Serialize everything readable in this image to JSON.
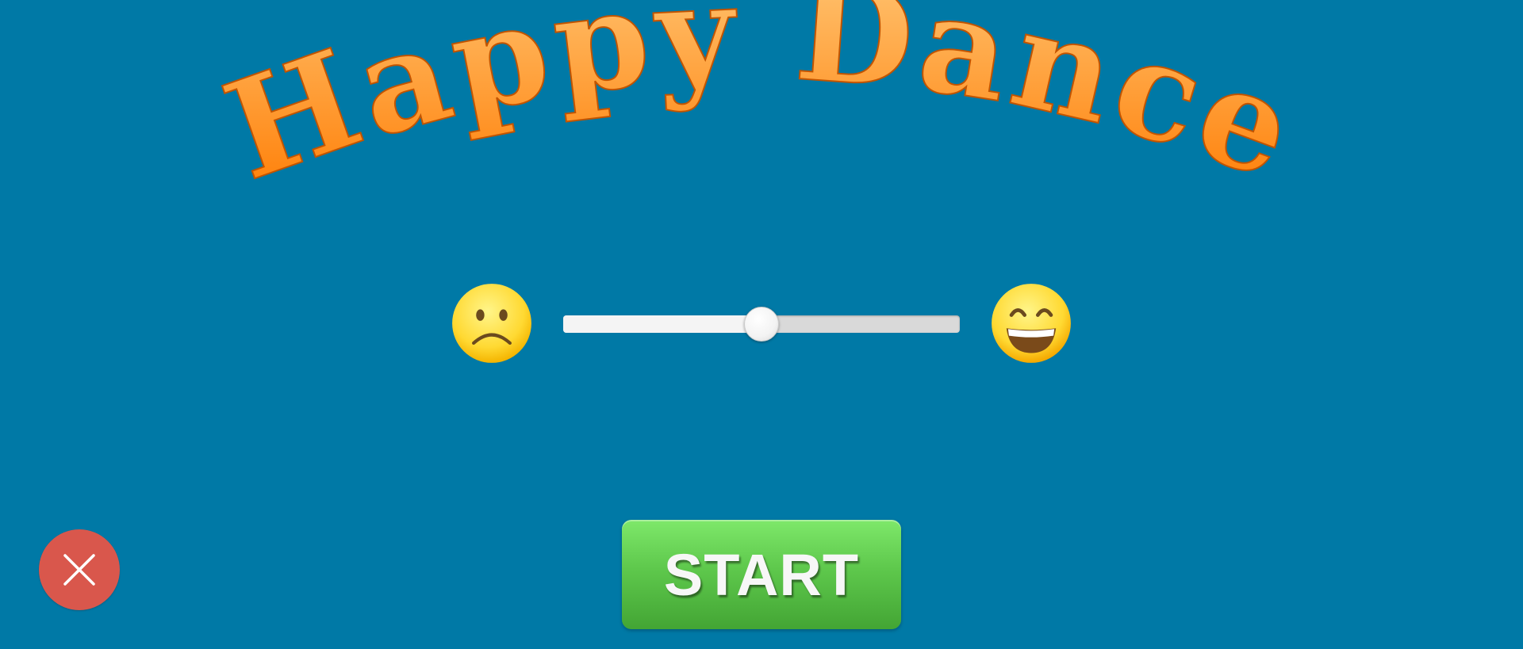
{
  "game": {
    "title": "Happy Dance",
    "start_label": "START"
  },
  "mood_slider": {
    "value": 0.5,
    "min_icon": "frowning-face-icon",
    "max_icon": "grinning-face-icon"
  },
  "close_button": {
    "icon": "close-icon"
  },
  "colors": {
    "background": "#0079a6",
    "title_top": "#ffc878",
    "title_bottom": "#ff7a00",
    "start_button": "#5ec84c",
    "close_button": "#d9574c"
  }
}
